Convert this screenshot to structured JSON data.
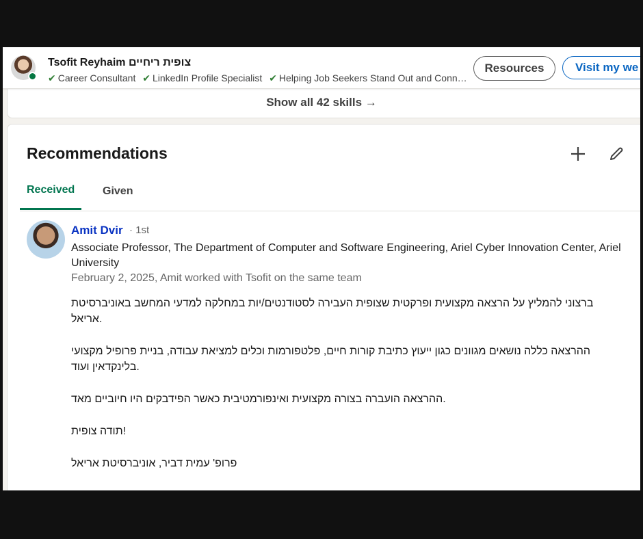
{
  "header": {
    "name": "Tsofit Reyhaim צופית ריחיים",
    "headline_items": [
      "Career Consultant",
      "LinkedIn Profile Specialist",
      "Helping Job Seekers Stand Out and Connec..."
    ],
    "resources_label": "Resources",
    "visit_label": "Visit my we"
  },
  "skills": {
    "show_all_label": "Show all 42 skills →"
  },
  "recommendations": {
    "title": "Recommendations",
    "tabs": [
      "Received",
      "Given"
    ],
    "active_tab": "Received",
    "items": [
      {
        "name": "Amit Dvir",
        "degree": "· 1st",
        "role": "Associate Professor, The Department of Computer and Software Engineering, Ariel Cyber Innovation Center, Ariel University",
        "date_line": "February 2, 2025, Amit worked with Tsofit on the same team",
        "paragraphs": [
          "ברצוני להמליץ על הרצאה מקצועית ופרקטית שצופית העבירה לסטודנטים/יות במחלקה למדעי המחשב באוניברסיטת אריאל.",
          "ההרצאה כללה נושאים מגוונים כגון ייעוץ כתיבת קורות חיים, פלטפורמות וכלים למציאת עבודה, בניית פרופיל מקצועי בלינקדאין ועוד.",
          "ההרצאה הועברה בצורה מקצועית ואינפורמטיבית כאשר הפידבקים היו חיוביים מאד.",
          "תודה צופית!",
          "פרופ' עמית דביר, אוניברסיטת אריאל"
        ]
      }
    ]
  }
}
